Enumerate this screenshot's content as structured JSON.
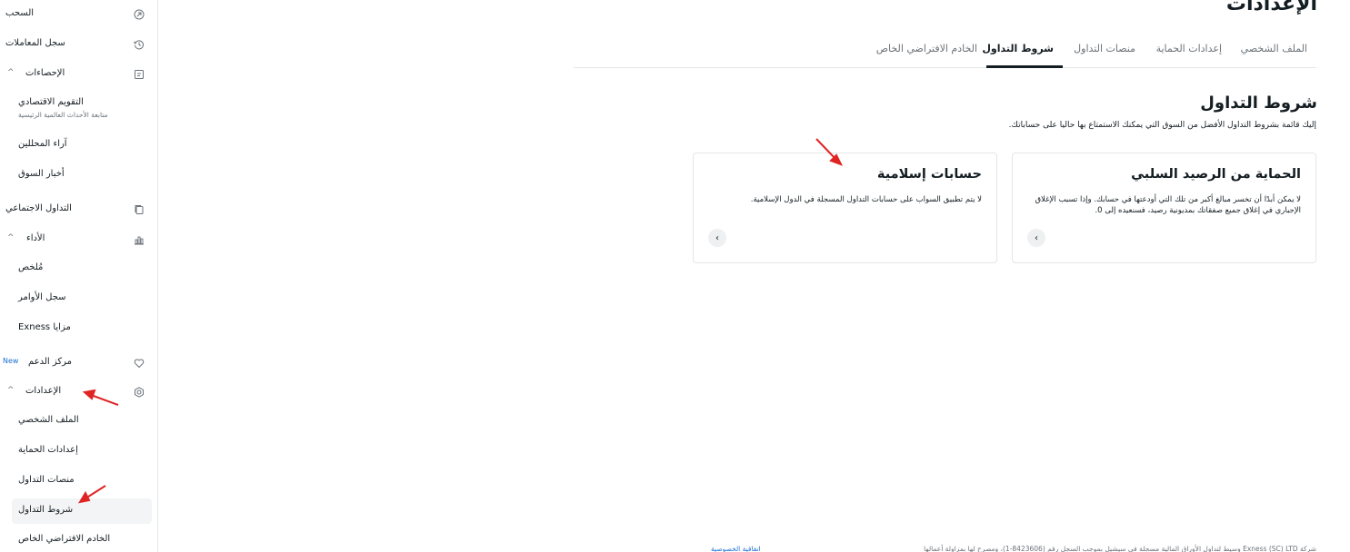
{
  "sidebar": {
    "items": [
      {
        "label": "السحب",
        "icon": "withdraw-icon"
      },
      {
        "label": "سجل المعاملات",
        "icon": "history-icon"
      },
      {
        "label": "الإحصاءات",
        "icon": "stats-icon"
      },
      {
        "label": "التداول الاجتماعي",
        "icon": "copy-icon"
      },
      {
        "label": "الأداء",
        "icon": "chart-icon"
      },
      {
        "label": "مركز الدعم",
        "icon": "heart-icon"
      },
      {
        "label": "الإعدادات",
        "icon": "gear-icon"
      }
    ],
    "stats_sub": [
      {
        "label": "التقويم الاقتصادي",
        "desc": "متابعة الأحداث العالمية الرئيسية"
      },
      {
        "label": "آراء المحللين"
      },
      {
        "label": "أخبار السوق"
      }
    ],
    "performance_sub": [
      {
        "label": "مُلخص"
      },
      {
        "label": "سجل الأوامر"
      },
      {
        "label": "مزايا Exness"
      }
    ],
    "settings_sub": [
      {
        "label": "الملف الشخصي"
      },
      {
        "label": "إعدادات الحماية"
      },
      {
        "label": "منصات التداول"
      },
      {
        "label": "شروط التداول"
      },
      {
        "label": "الخادم الافتراضي الخاص"
      }
    ],
    "new_badge": "New"
  },
  "page": {
    "title": "الإعدادات"
  },
  "tabs": [
    {
      "label": "الملف الشخصي"
    },
    {
      "label": "إعدادات الحماية"
    },
    {
      "label": "منصات التداول"
    },
    {
      "label": "شروط التداول",
      "active": true
    },
    {
      "label": "الخادم الافتراضي الخاص"
    }
  ],
  "section": {
    "title": "شروط التداول",
    "description": "إليك قائمة بشروط التداول الأفضل من السوق التي يمكنك الاستمتاع بها حاليا على حساباتك."
  },
  "cards": [
    {
      "title": "الحماية من الرصيد السلبي",
      "text": "لا يمكن أبدًا أن تخسر مبالغ أكبر من تلك التي أودعتها في حسابك. وإذا تسبب الإغلاق الإجباري في إغلاق جميع صفقاتك بمديونية رصيد، فسنعيده إلى 0.",
      "button_icon": "chevron-left-icon"
    },
    {
      "title": "حسابات إسلامية",
      "text": "لا يتم تطبيق السواب على حسابات التداول المسجلة في الدول الإسلامية.",
      "button_icon": "chevron-left-icon"
    }
  ],
  "footer": {
    "text": "شركة Exness (SC) LTD وسيط لتداول الأوراق المالية مسجلة في سيشيل بموجب السجل رقم (8423606-1)، ومصرح لها بمزاولة أعمالها",
    "link": "اتفاقية الخصوصية"
  },
  "colors": {
    "accent": "#141d22",
    "link": "#1d6fd1",
    "annotation": "#e02424"
  }
}
